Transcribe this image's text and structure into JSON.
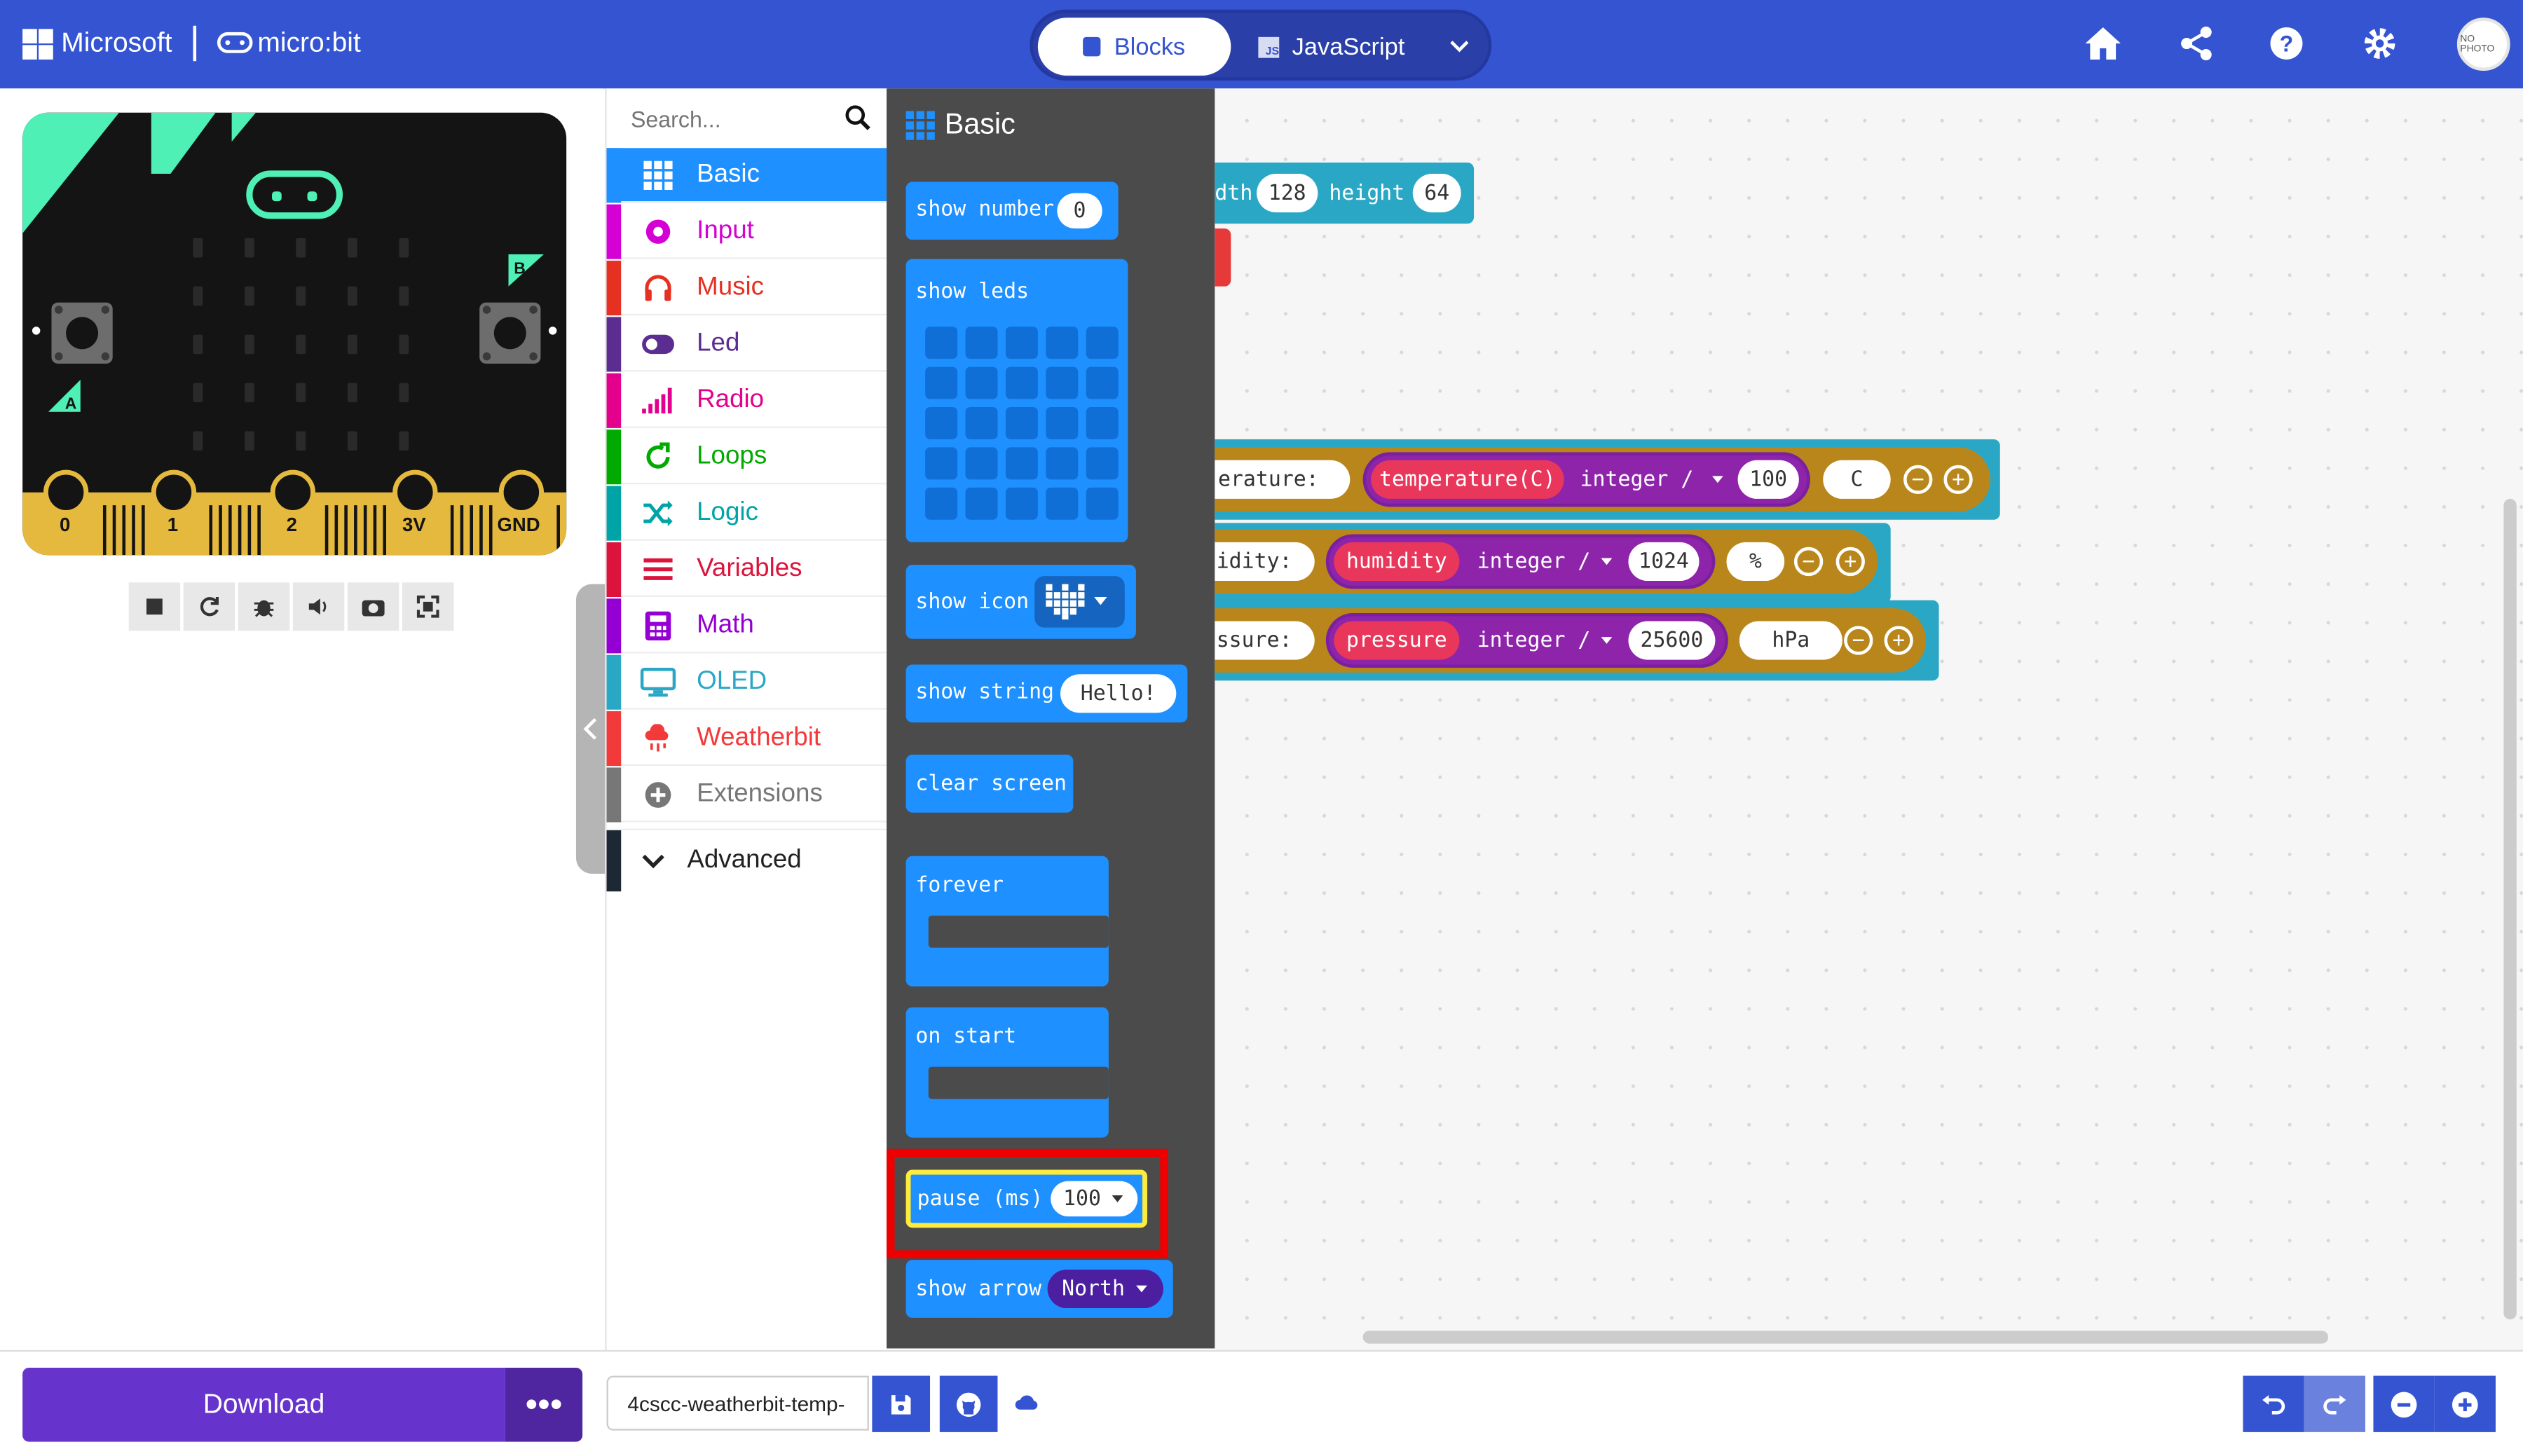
{
  "header": {
    "brand_microsoft": "Microsoft",
    "brand_microbit": "micro:bit",
    "tab_blocks": "Blocks",
    "tab_javascript": "JavaScript",
    "avatar_text": "NO PHOTO"
  },
  "simulator": {
    "pins": [
      "0",
      "1",
      "2",
      "3V",
      "GND"
    ],
    "button_a": "A",
    "button_b": "B"
  },
  "toolbox": {
    "search_placeholder": "Search...",
    "categories": [
      {
        "label": "Basic",
        "color": "#1e90ff",
        "icon": "grid-icon"
      },
      {
        "label": "Input",
        "color": "#d400d4",
        "icon": "target-icon"
      },
      {
        "label": "Music",
        "color": "#e63022",
        "icon": "headphones-icon"
      },
      {
        "label": "Led",
        "color": "#5c2d91",
        "icon": "toggle-icon"
      },
      {
        "label": "Radio",
        "color": "#e3008c",
        "icon": "signal-bars-icon"
      },
      {
        "label": "Loops",
        "color": "#00aa00",
        "icon": "refresh-icon"
      },
      {
        "label": "Logic",
        "color": "#00a4a6",
        "icon": "shuffle-icon"
      },
      {
        "label": "Variables",
        "color": "#dc143c",
        "icon": "list-icon"
      },
      {
        "label": "Math",
        "color": "#9400d3",
        "icon": "calculator-icon"
      },
      {
        "label": "OLED",
        "color": "#2ba7c6",
        "icon": "monitor-icon"
      },
      {
        "label": "Weatherbit",
        "color": "#f23a3a",
        "icon": "cloud-rain-icon"
      },
      {
        "label": "Extensions",
        "color": "#777777",
        "icon": "plus-circle-icon"
      }
    ],
    "advanced": "Advanced"
  },
  "flyout": {
    "title": "Basic",
    "show_number": "show number",
    "show_number_value": "0",
    "show_leds": "show leds",
    "show_icon": "show icon",
    "show_string": "show string",
    "show_string_value": "Hello!",
    "clear_screen": "clear screen",
    "forever": "forever",
    "on_start": "on start",
    "pause": "pause (ms)",
    "pause_value": "100",
    "show_arrow": "show arrow",
    "show_arrow_value": "North"
  },
  "workspace": {
    "oled_width_label": "dth",
    "oled_width": "128",
    "oled_height_label": "height",
    "oled_height": "64",
    "rows": [
      {
        "label": "erature:",
        "reading": "temperature(C)",
        "op": "integer /",
        "divisor": "100",
        "unit": "C"
      },
      {
        "label": "idity:",
        "reading": "humidity",
        "op": "integer /",
        "divisor": "1024",
        "unit": "%"
      },
      {
        "label": "ssure:",
        "reading": "pressure",
        "op": "integer /",
        "divisor": "25600",
        "unit": "hPa"
      }
    ]
  },
  "footer": {
    "download": "Download",
    "more": "•••",
    "project_name": "4cscc-weatherbit-temp-"
  }
}
